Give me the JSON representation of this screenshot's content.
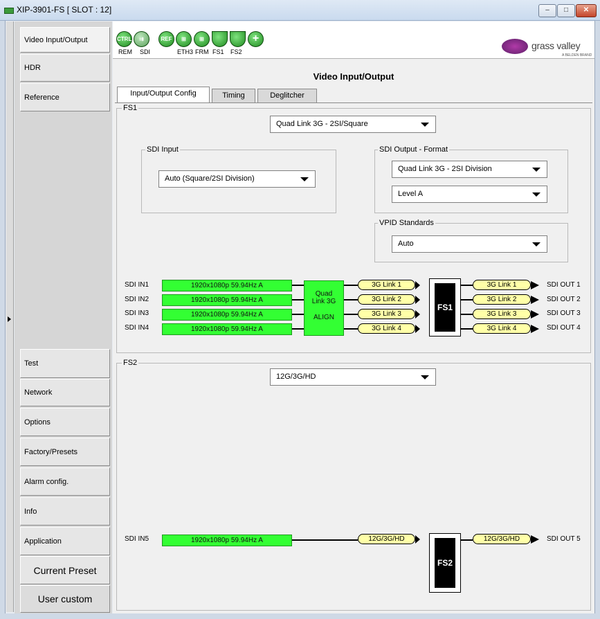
{
  "window": {
    "title": "XIP-3901-FS [ SLOT : 12]",
    "minimize": "–",
    "maximize": "□",
    "close": "✕"
  },
  "nav": {
    "items": [
      {
        "label": "Video Input/Output"
      },
      {
        "label": "HDR"
      },
      {
        "label": "Reference"
      },
      {
        "label": "Test"
      },
      {
        "label": "Network"
      },
      {
        "label": "Options"
      },
      {
        "label": "Factory/Presets"
      },
      {
        "label": "Alarm config."
      },
      {
        "label": "Info"
      },
      {
        "label": "Application"
      },
      {
        "label": "Current Preset"
      },
      {
        "label": "User custom"
      }
    ]
  },
  "status_icons": [
    {
      "icon": "ctrl-icon",
      "glyph": "CTRL",
      "label": "REM"
    },
    {
      "icon": "sdi-icon",
      "glyph": "⇉",
      "label": "SDI"
    },
    {
      "icon": "ref-icon",
      "glyph": "REF",
      "label": ""
    },
    {
      "icon": "eth-icon",
      "glyph": "⊞",
      "label": "ETH3"
    },
    {
      "icon": "frm-icon",
      "glyph": "⊞",
      "label": "FRM"
    },
    {
      "icon": "fs1-icon",
      "glyph": "",
      "label": "FS1"
    },
    {
      "icon": "fs2-icon",
      "glyph": "",
      "label": "FS2"
    },
    {
      "icon": "add-icon",
      "glyph": "+",
      "label": ""
    }
  ],
  "logo": {
    "text": "grass valley",
    "sub": "A BELDEN BRAND"
  },
  "page_title": "Video Input/Output",
  "tabs": [
    {
      "label": "Input/Output Config"
    },
    {
      "label": "Timing"
    },
    {
      "label": "Deglitcher"
    }
  ],
  "fs1": {
    "label": "FS1",
    "mode": "Quad Link 3G - 2SI/Square",
    "sdi_input": {
      "label": "SDI Input",
      "value": "Auto (Square/2SI Division)"
    },
    "sdi_output": {
      "label": "SDI Output - Format",
      "format": "Quad Link 3G - 2SI Division",
      "level": "Level A"
    },
    "vpid": {
      "label": "VPID Standards",
      "value": "Auto"
    },
    "inputs": [
      {
        "name": "SDI IN1",
        "signal": "1920x1080p 59.94Hz A"
      },
      {
        "name": "SDI IN2",
        "signal": "1920x1080p 59.94Hz A"
      },
      {
        "name": "SDI IN3",
        "signal": "1920x1080p 59.94Hz A"
      },
      {
        "name": "SDI IN4",
        "signal": "1920x1080p 59.94Hz A"
      }
    ],
    "align_block": {
      "line1": "Quad",
      "line2": "Link 3G",
      "line3": "ALIGN"
    },
    "in_links": [
      "3G Link 1",
      "3G Link 2",
      "3G Link 3",
      "3G Link 4"
    ],
    "block": "FS1",
    "out_links": [
      "3G Link 1",
      "3G Link 2",
      "3G Link 3",
      "3G Link 4"
    ],
    "outputs": [
      "SDI OUT 1",
      "SDI OUT 2",
      "SDI OUT 3",
      "SDI OUT 4"
    ]
  },
  "fs2": {
    "label": "FS2",
    "mode": "12G/3G/HD",
    "input": {
      "name": "SDI IN5",
      "signal": "1920x1080p 59.94Hz A"
    },
    "in_link": "12G/3G/HD",
    "block": "FS2",
    "out_link": "12G/3G/HD",
    "output": "SDI OUT 5"
  }
}
